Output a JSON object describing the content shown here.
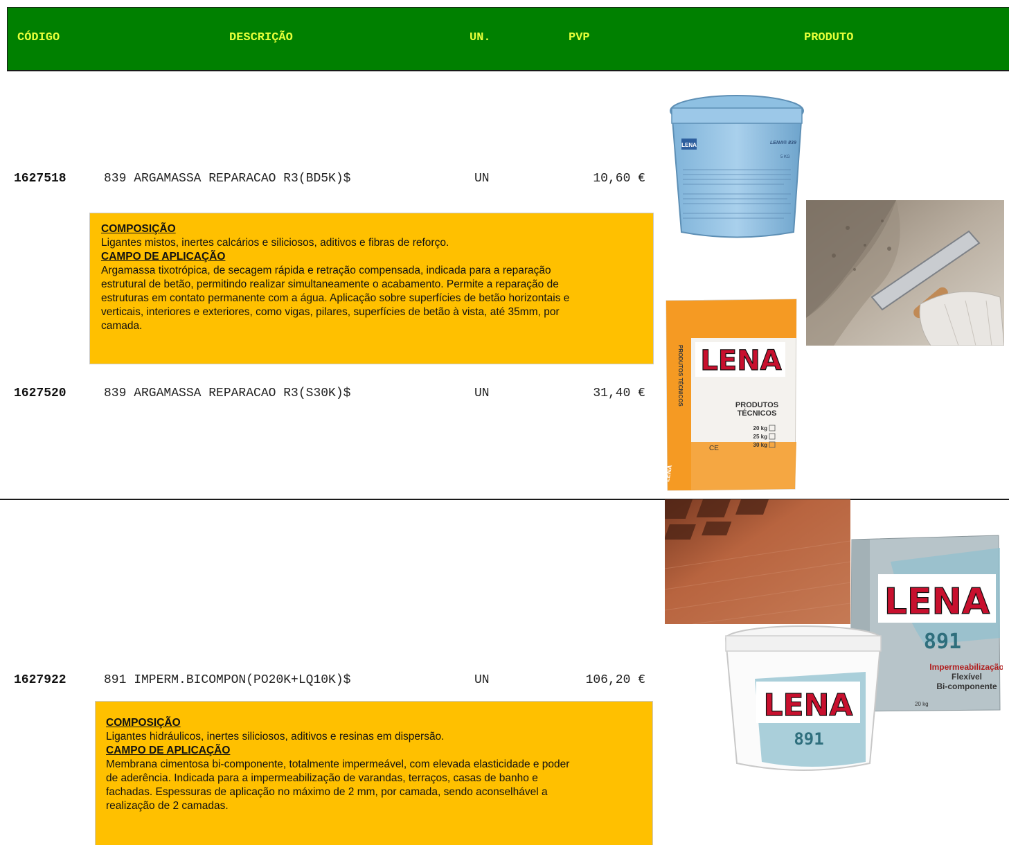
{
  "header": {
    "code": "CÓDIGO",
    "description": "DESCRIÇÃO",
    "unit": "UN.",
    "price": "PVP",
    "product": "PRODUTO"
  },
  "products": [
    {
      "code": "1627518",
      "description": "839 ARGAMASSA REPARACAO R3(BD5K)$",
      "unit": "UN",
      "price": "10,60 €"
    },
    {
      "code": "1627520",
      "description": "839 ARGAMASSA REPARACAO R3(S30K)$",
      "unit": "UN",
      "price": "31,40 €"
    },
    {
      "code": "1627922",
      "description": "891 IMPERM.BICOMPON(PO20K+LQ10K)$",
      "unit": "UN",
      "price": "106,20 €"
    }
  ],
  "info_839": {
    "composition_heading": "COMPOSIÇÃO",
    "composition_text": "Ligantes mistos, inertes calcários e siliciosos, aditivos e fibras de reforço.",
    "application_heading": "CAMPO DE APLICAÇÃO",
    "application_line1": "Argamassa tixotrópica, de secagem rápida e retração compensada, indicada para a reparação",
    "application_line2": "estrutural de betão, permitindo realizar simultaneamente o acabamento. Permite a reparação de",
    "application_line3": "estruturas em contato permanente com a água. Aplicação sobre superfícies de betão horizontais e",
    "application_line4": "verticais, interiores e exteriores, como vigas, pilares, superfícies de betão à vista, até 35mm, por",
    "application_line5": "camada."
  },
  "info_891": {
    "composition_heading": "COMPOSIÇÃO",
    "composition_text": "Ligantes hidráulicos, inertes siliciosos, aditivos e resinas em dispersão.",
    "application_heading": "CAMPO DE APLICAÇÃO",
    "application_line1": "Membrana cimentosa bi-componente, totalmente impermeável, com elevada elasticidade e poder",
    "application_line2": "de aderência. Indicada para a impermeabilização de varandas, terraços, casas de banho e",
    "application_line3": "fachadas. Espessuras de aplicação no máximo de 2 mm, por camada, sendo aconselhável a",
    "application_line4": "realização de 2 camadas."
  },
  "images": {
    "bucket_839": {
      "brand": "LENA",
      "label": "LENA® 839",
      "volume": "5 KG"
    },
    "bag_839": {
      "brand": "LENA",
      "side_text": "PRODUTOS TÉCNICOS",
      "title_line1": "PRODUTOS",
      "title_line2": "TÉCNICOS",
      "weight1": "20 kg",
      "weight2": "25 kg",
      "weight3": "30 kg",
      "ce": "CE",
      "footer": "LENA"
    },
    "bag_891": {
      "brand": "LENA",
      "model": "891",
      "title_line1": "Impermeabilização",
      "title_line2": "Flexível",
      "title_line3": "Bi-componente",
      "weight": "20 kg"
    },
    "bucket_891": {
      "brand": "LENA",
      "model": "891"
    }
  },
  "colors": {
    "header_bg": "#008000",
    "header_text": "#e6ff3a",
    "info_bg": "#ffc000"
  }
}
